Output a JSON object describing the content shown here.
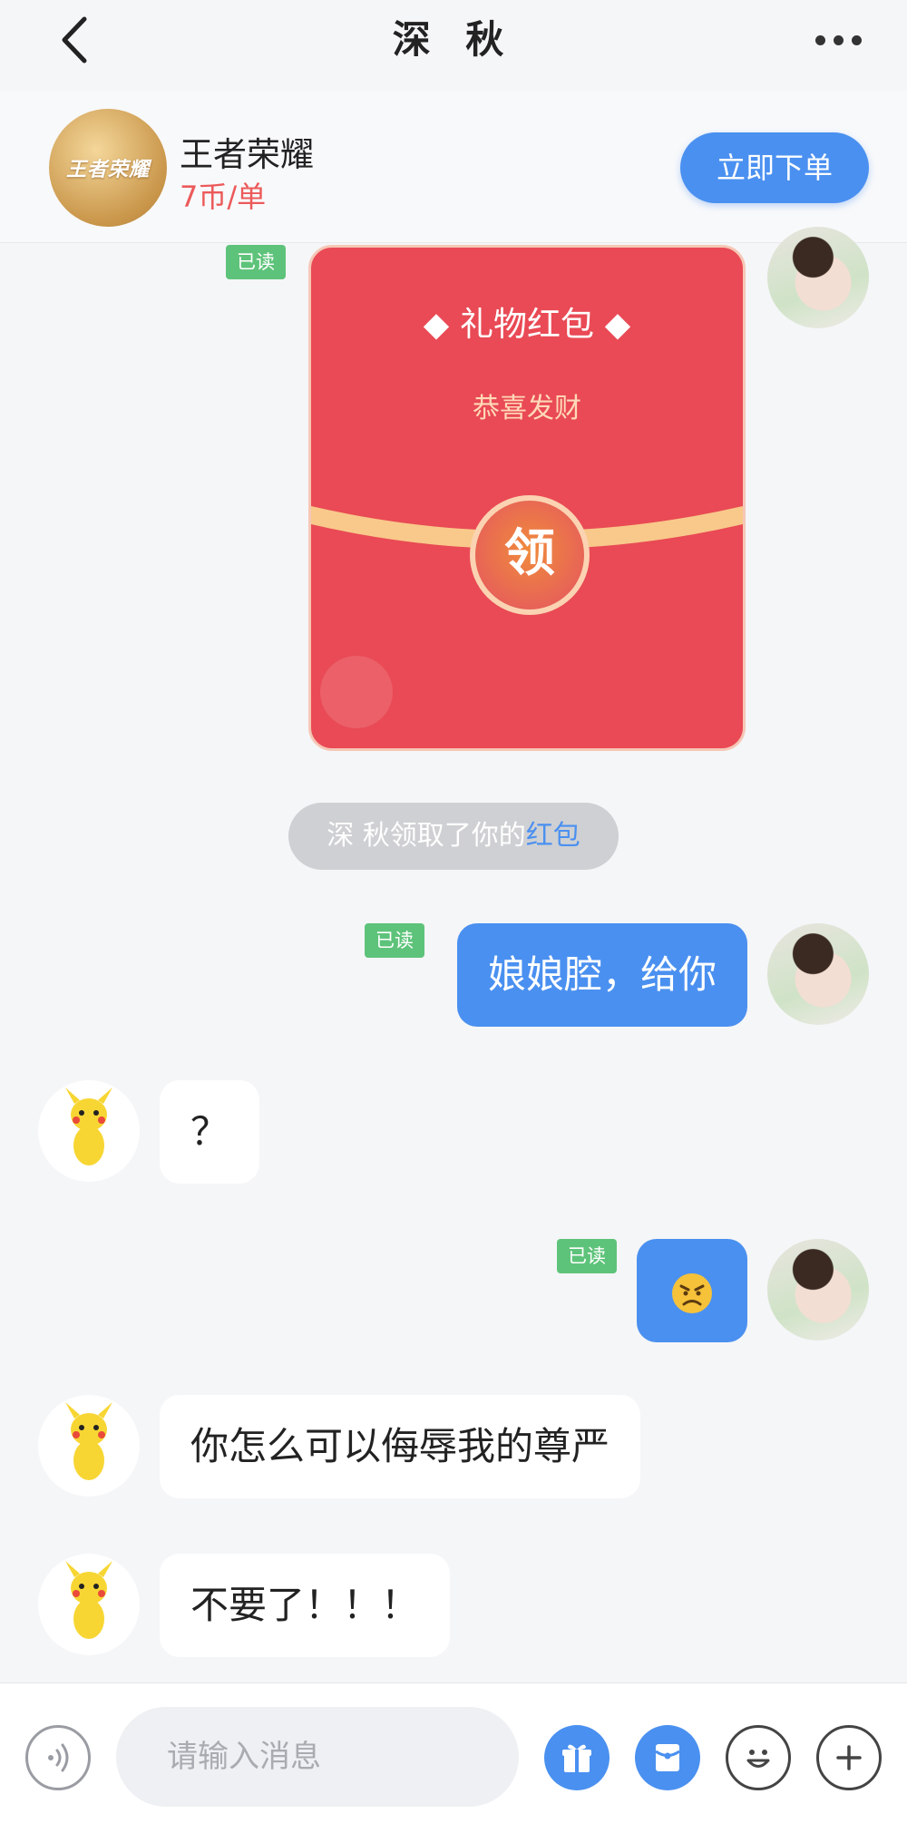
{
  "header": {
    "title": "深 秋",
    "back_icon": "chevron-left-icon",
    "more_icon": "more-horizontal-icon"
  },
  "order_bar": {
    "game_logo_text": "王者荣耀",
    "game_name": "王者荣耀",
    "price": "7币/单",
    "order_button": "立即下单"
  },
  "read_label": "已读",
  "red_packet": {
    "title": "◆ 礼物红包 ◆",
    "greeting": "恭喜发财",
    "open_label": "领"
  },
  "notice": {
    "prefix": "深 秋领取了你的",
    "highlight": "红包"
  },
  "messages": [
    {
      "from": "me",
      "text": "娘娘腔，给你"
    },
    {
      "from": "them",
      "text": "？"
    },
    {
      "from": "me",
      "text": "😠"
    },
    {
      "from": "them",
      "text": "你怎么可以侮辱我的尊严"
    },
    {
      "from": "them",
      "text": "不要了！！！"
    }
  ],
  "input_bar": {
    "placeholder": "请输入消息",
    "voice_icon": "voice-icon",
    "gift_icon": "gift-icon",
    "red_packet_icon": "red-packet-icon",
    "emoji_icon": "emoji-icon",
    "plus_icon": "plus-icon"
  },
  "colors": {
    "accent": "#4a90f0",
    "read_badge": "#5ec37a",
    "price": "#ec5a5a",
    "packet": "#e94a55"
  }
}
